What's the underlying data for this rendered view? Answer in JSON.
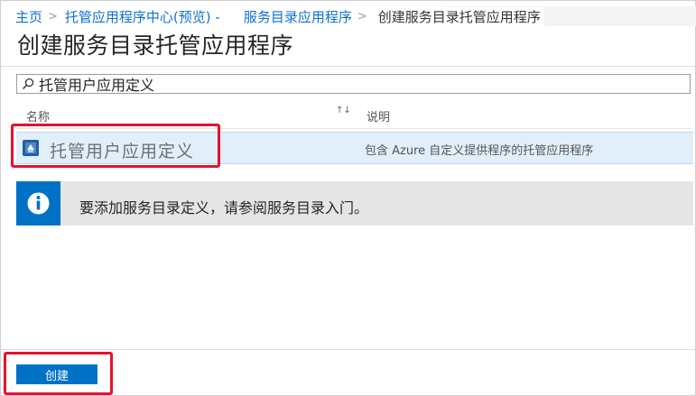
{
  "breadcrumb": {
    "items": [
      "主页",
      "托管应用程序中心(预览) -",
      "服务目录应用程序"
    ],
    "separator": ">",
    "current": "创建服务目录托管应用程序"
  },
  "page": {
    "title": "创建服务目录托管应用程序"
  },
  "search": {
    "value": "托管用户应用定义",
    "icon": "search-icon"
  },
  "table": {
    "columns": [
      {
        "label": "名称",
        "sort_icon": "↑↓"
      },
      {
        "label": "说明"
      }
    ],
    "rows": [
      {
        "icon": "managed-app-icon",
        "name": "托管用户应用定义",
        "description": "包含 Azure 自定义提供程序的托管应用程序"
      }
    ]
  },
  "info": {
    "icon": "info-icon",
    "text": "要添加服务目录定义，请参阅服务目录入门。"
  },
  "footer": {
    "create_label": "创建"
  },
  "colors": {
    "accent": "#0072c6",
    "link": "#1170cf",
    "highlight": "#e8112d",
    "selected_row": "#e1effb"
  }
}
